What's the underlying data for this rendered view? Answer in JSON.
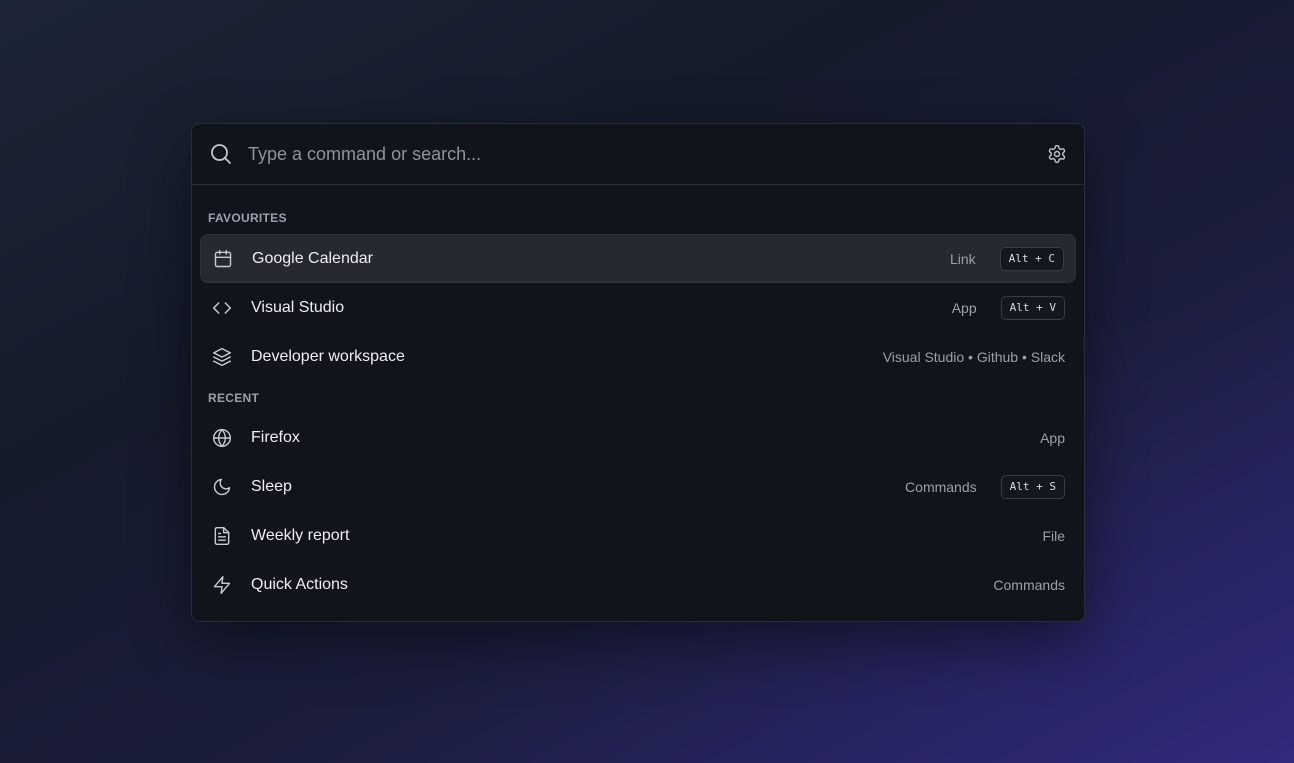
{
  "search": {
    "placeholder": "Type a command or search..."
  },
  "sections": {
    "favourites": "FAVOURITES",
    "recent": "RECENT"
  },
  "favourites": [
    {
      "label": "Google Calendar",
      "meta": "Link",
      "shortcut": "Alt + C",
      "icon": "calendar-icon"
    },
    {
      "label": "Visual Studio",
      "meta": "App",
      "shortcut": "Alt + V",
      "icon": "code-icon"
    },
    {
      "label": "Developer workspace",
      "meta": "Visual Studio • Github • Slack",
      "icon": "layers-icon"
    }
  ],
  "recent": [
    {
      "label": "Firefox",
      "meta": "App",
      "icon": "globe-icon"
    },
    {
      "label": "Sleep",
      "meta": "Commands",
      "shortcut": "Alt + S",
      "icon": "moon-icon"
    },
    {
      "label": "Weekly report",
      "meta": "File",
      "icon": "file-text-icon"
    },
    {
      "label": "Quick Actions",
      "meta": "Commands",
      "icon": "lightning-icon"
    }
  ],
  "colors": {
    "panel_bg": "#11141b",
    "active_row_bg": "#262931",
    "border": "#2a2e39",
    "text_primary": "#eceef2",
    "text_muted": "#9ba0ac"
  }
}
